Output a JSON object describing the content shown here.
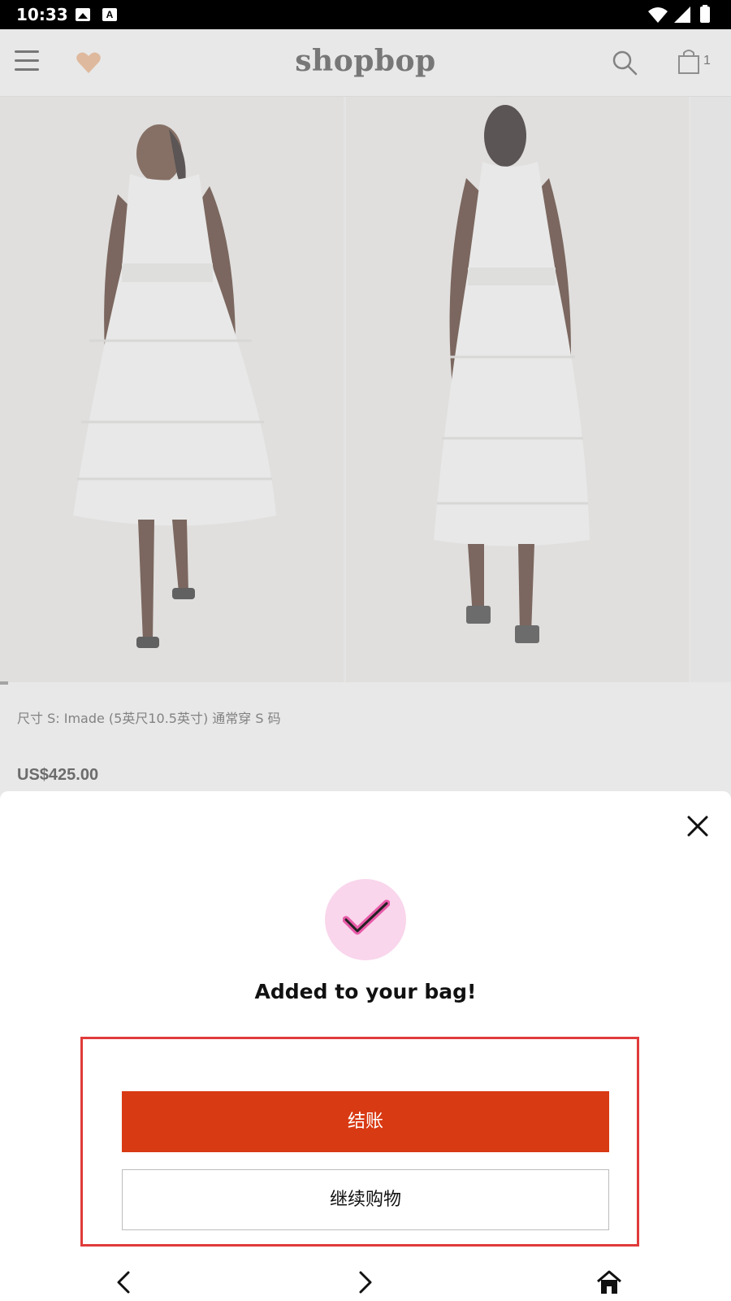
{
  "status_bar": {
    "time": "10:33",
    "icons": [
      "photo-icon",
      "font-a-icon",
      "wifi-icon",
      "cell-signal-icon",
      "battery-icon"
    ]
  },
  "header": {
    "brand": "shopbop",
    "bag_count": "1",
    "icons": [
      "hamburger-menu-icon",
      "heart-icon",
      "search-icon",
      "shopping-bag-icon"
    ],
    "colors": {
      "heart": "#f3b98f"
    }
  },
  "product": {
    "size_note": "尺寸 S: Imade (5英尺10.5英寸) 通常穿 S 码",
    "price": "US$425.00"
  },
  "sheet": {
    "title": "Added to your bag!",
    "checkout_label": "结账",
    "continue_label": "继续购物",
    "colors": {
      "checkout_bg": "#d83a13",
      "check_circle_bg": "#f9d6ec",
      "highlight_border": "#e03b3b"
    }
  },
  "nav": {
    "icons": [
      "back-chevron-icon",
      "forward-chevron-icon",
      "home-icon"
    ]
  }
}
